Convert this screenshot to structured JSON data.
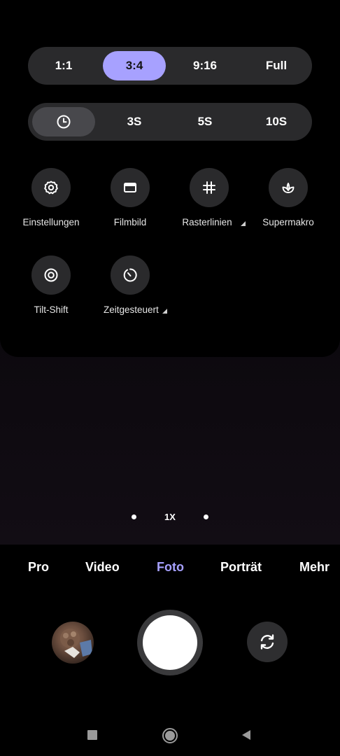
{
  "aspect_ratio": {
    "options": [
      "1:1",
      "3:4",
      "9:16",
      "Full"
    ],
    "selected": "3:4"
  },
  "timer": {
    "options": [
      "timer-icon",
      "3S",
      "5S",
      "10S"
    ],
    "selected_icon": "clock-icon"
  },
  "tiles": {
    "settings": "Einstellungen",
    "film_frame": "Filmbild",
    "grid_lines": "Rasterlinien",
    "super_macro": "Supermakro",
    "tilt_shift": "Tilt-Shift",
    "timed": "Zeitgesteuert"
  },
  "zoom": {
    "level": "1X"
  },
  "modes": {
    "pro": "Pro",
    "video": "Video",
    "photo": "Foto",
    "portrait": "Porträt",
    "more": "Mehr",
    "active": "Foto"
  },
  "colors": {
    "accent": "#a7a1ff",
    "panel": "#2a2a2c"
  }
}
